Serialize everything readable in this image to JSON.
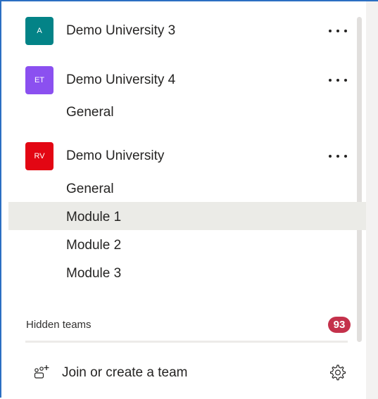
{
  "teams": [
    {
      "initials": "A",
      "name": "Demo University 3",
      "color": "#038387"
    },
    {
      "initials": "ET",
      "name": "Demo University 4",
      "color": "#8b50f0"
    },
    {
      "initials": "RV",
      "name": "Demo University",
      "color": "#e30613"
    }
  ],
  "channels": {
    "team4": [
      "General"
    ],
    "demo": [
      "General",
      "Module 1",
      "Module 2",
      "Module 3"
    ]
  },
  "selected_channel": "Module 1",
  "hidden_teams": {
    "label": "Hidden teams",
    "count": "93"
  },
  "footer": {
    "join_label": "Join or create a team"
  },
  "icons": [
    "more-options-icon",
    "join-team-icon",
    "gear-icon"
  ],
  "colors": {
    "accent": "#2b6fc2",
    "badge": "#c4314b",
    "selected_bg": "#ebebe7"
  }
}
